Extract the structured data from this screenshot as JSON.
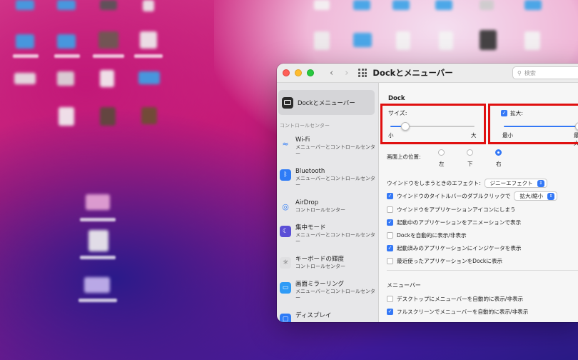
{
  "window": {
    "title": "Dockとメニューバー",
    "search_placeholder": "検索",
    "back_icon": "chevron-left-icon",
    "forward_icon": "chevron-right-icon"
  },
  "sidebar": {
    "selected_label": "Dockとメニューバー",
    "section_label": "コントロールセンター",
    "items": [
      {
        "title": "Wi-Fi",
        "subtitle": "メニューバーとコントロールセンター",
        "icon": "wifi-icon",
        "color": "#2f7cf6"
      },
      {
        "title": "Bluetooth",
        "subtitle": "メニューバーとコントロールセンター",
        "icon": "bluetooth-icon",
        "color": "#2f7cf6"
      },
      {
        "title": "AirDrop",
        "subtitle": "コントロールセンター",
        "icon": "airdrop-icon",
        "color": "#2f7cf6"
      },
      {
        "title": "集中モード",
        "subtitle": "メニューバーとコントロールセンター",
        "icon": "moon-icon",
        "color": "#5b4fd6"
      },
      {
        "title": "キーボードの輝度",
        "subtitle": "コントロールセンター",
        "icon": "keyboard-brightness-icon",
        "color": "#8e8e93"
      },
      {
        "title": "画面ミラーリング",
        "subtitle": "メニューバーとコントロールセンター",
        "icon": "screen-mirroring-icon",
        "color": "#2f7cf6"
      },
      {
        "title": "ディスプレイ",
        "subtitle": "",
        "icon": "display-icon",
        "color": "#2f7cf6"
      }
    ]
  },
  "main": {
    "dock_title": "Dock",
    "size": {
      "label": "サイズ:",
      "min": "小",
      "max": "大",
      "value": 0.12
    },
    "magnify": {
      "label": "拡大:",
      "checked": true,
      "min": "最小",
      "max": "最大",
      "value": 1.0
    },
    "position": {
      "label": "画面上の位置:",
      "options": [
        "左",
        "下",
        "右"
      ],
      "selected": "右"
    },
    "effect": {
      "label": "ウインドウをしまうときのエフェクト:",
      "value": "ジニーエフェクト"
    },
    "double_click": {
      "label": "ウインドウのタイトルバーのダブルクリックで",
      "value": "拡大/縮小",
      "checked": true
    },
    "checkboxes": [
      {
        "label": "ウインドウをアプリケーションアイコンにしまう",
        "checked": false
      },
      {
        "label": "起動中のアプリケーションをアニメーションで表示",
        "checked": true
      },
      {
        "label": "Dockを自動的に表示/非表示",
        "checked": false
      },
      {
        "label": "起動済みのアプリケーションにインジケータを表示",
        "checked": true
      },
      {
        "label": "最近使ったアプリケーションをDockに表示",
        "checked": false
      }
    ],
    "menubar_title": "メニューバー",
    "menubar_checkboxes": [
      {
        "label": "デスクトップにメニューバーを自動的に表示/非表示",
        "checked": false
      },
      {
        "label": "フルスクリーンでメニューバーを自動的に表示/非表示",
        "checked": true
      }
    ]
  },
  "colors": {
    "accent": "#3478f6",
    "annotation": "#e01010"
  }
}
